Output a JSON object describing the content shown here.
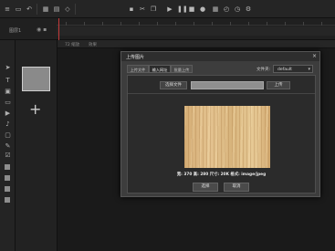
{
  "toolbar": {
    "icons": [
      "menu-icon",
      "grid-icon",
      "play-icon",
      "stop-icon",
      "lock-icon",
      "eye-icon",
      "clock-icon"
    ]
  },
  "timeline": {
    "layer_name": "图层1"
  },
  "canvas": {
    "tabs": [
      "72 缩放",
      "效果"
    ]
  },
  "dialog": {
    "title": "上传图片",
    "close_glyph": "×",
    "tabs": [
      "上传文件",
      "输入网址",
      "批量上传"
    ],
    "active_tab": 1,
    "library_label": "文件夹:",
    "library_value": "default",
    "select_file_label": "选择文件",
    "file_value": "",
    "upload_label": "上传",
    "image_info": "宽: 370  高: 280  尺寸: 20K  格式: image/jpeg",
    "ok_label": "选择",
    "cancel_label": "取消"
  }
}
